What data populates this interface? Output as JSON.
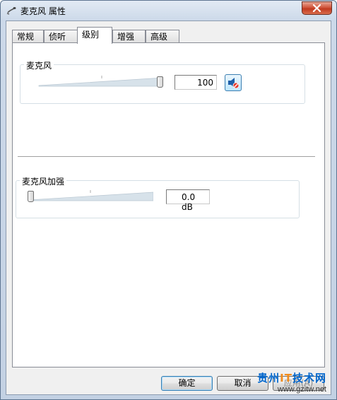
{
  "window": {
    "title": "麦克风 属性",
    "close_icon": "close-x-icon",
    "title_icon": "microphone-icon"
  },
  "tabs": [
    {
      "label": "常规",
      "active": false
    },
    {
      "label": "侦听",
      "active": false
    },
    {
      "label": "级别",
      "active": true
    },
    {
      "label": "增强",
      "active": false
    },
    {
      "label": "高级",
      "active": false
    }
  ],
  "microphone": {
    "label": "麦克风",
    "level": 100,
    "level_fraction": 1.0,
    "value": "100",
    "mute_icon": "speaker-mute-icon"
  },
  "boost": {
    "label": "麦克风加强",
    "level_fraction": 0.0,
    "value": "0.0 dB"
  },
  "buttons": {
    "ok": "确定",
    "cancel": "取消",
    "apply": "应用(A)"
  },
  "watermark": {
    "title_a": "贵州",
    "title_it": "IT",
    "title_b": "技术网",
    "url": "www.gzitw.net"
  },
  "colors": {
    "title_gradient_top": "#e2eaf4",
    "close_red": "#c13a20",
    "accent_blue": "#3c7fb1"
  }
}
